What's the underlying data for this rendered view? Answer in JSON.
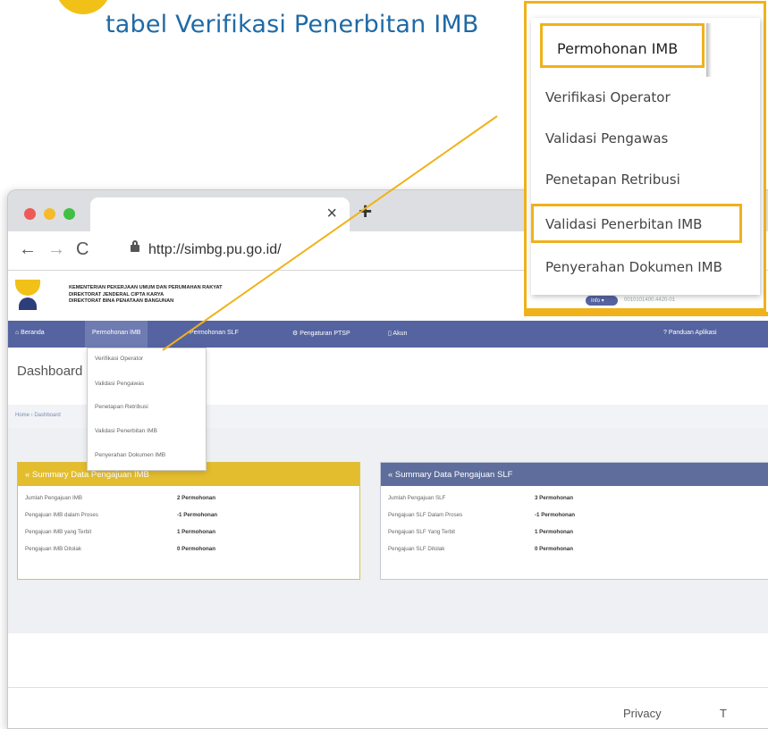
{
  "step": {
    "title": "tabel Verifikasi Penerbitan IMB"
  },
  "browser": {
    "tab_close": "×",
    "new_tab": "+",
    "nav": {
      "back": "←",
      "forward": "→",
      "reload": "C"
    },
    "url": "http://simbg.pu.go.id/"
  },
  "site": {
    "org_lines": [
      "KEMENTERIAN PEKERJAAN UMUM DAN PERUMAHAN RAKYAT",
      "DIREKTORAT JENDERAL CIPTA KARYA",
      "DIREKTORAT BINA PENATAAN BANGUNAN"
    ],
    "menu": {
      "beranda": "⌂ Beranda",
      "permohonan_imb": "Permohonan IMB",
      "permohonan_slf": "Permohonan SLF",
      "pengaturan_ptsp": "⚙ Pengaturan PTSP",
      "akun": "▯ Akun",
      "panduan": "? Panduan Aplikasi"
    },
    "page_title": "Dashboard",
    "breadcrumb": "Home › Dashboard",
    "dropdown": [
      "Verifikasi Operator",
      "Validasi Pengawas",
      "Penetapan Retribusi",
      "Validasi Penerbitan IMB",
      "Penyerahan Dokumen IMB"
    ],
    "imb_card": {
      "title": "« Summary Data Pengajuan IMB",
      "rows": [
        {
          "label": "Jumlah Pengajuan IMB",
          "value": "2 Permohonan"
        },
        {
          "label": "Pengajuan IMB dalam Proses",
          "value": "-1 Permohonan"
        },
        {
          "label": "Pengajuan IMB yang Terbit",
          "value": "1 Permohonan"
        },
        {
          "label": "Pengajuan IMB Ditolak",
          "value": "0 Permohonan"
        }
      ]
    },
    "slf_card": {
      "title": "« Summary Data Pengajuan SLF",
      "rows": [
        {
          "label": "Jumlah Pengajuan SLF",
          "value": "3 Permohonan"
        },
        {
          "label": "Pengajuan SLF Dalam Proses",
          "value": "-1 Permohonan"
        },
        {
          "label": "Pengajuan SLF Yang Terbit",
          "value": "1 Permohonan"
        },
        {
          "label": "Pengajuan SLF Ditolak",
          "value": "0 Permohonan"
        }
      ]
    },
    "footer": {
      "privacy": "Privacy",
      "terms": "T"
    }
  },
  "callout": {
    "menu_title": "Permohonan IMB",
    "items": [
      "Verifikasi Operator",
      "Validasi Pengawas",
      "Penetapan Retribusi",
      "Validasi Penerbitan IMB",
      "Penyerahan Dokumen IMB"
    ],
    "info_badge": "Info ▾",
    "user_text": "0010101400.4420-01"
  },
  "colors": {
    "accent_yellow": "#f0b21b",
    "title_blue": "#1f6aa6",
    "menu_blue": "#5564a0",
    "slf_header": "#5e6d9b"
  }
}
